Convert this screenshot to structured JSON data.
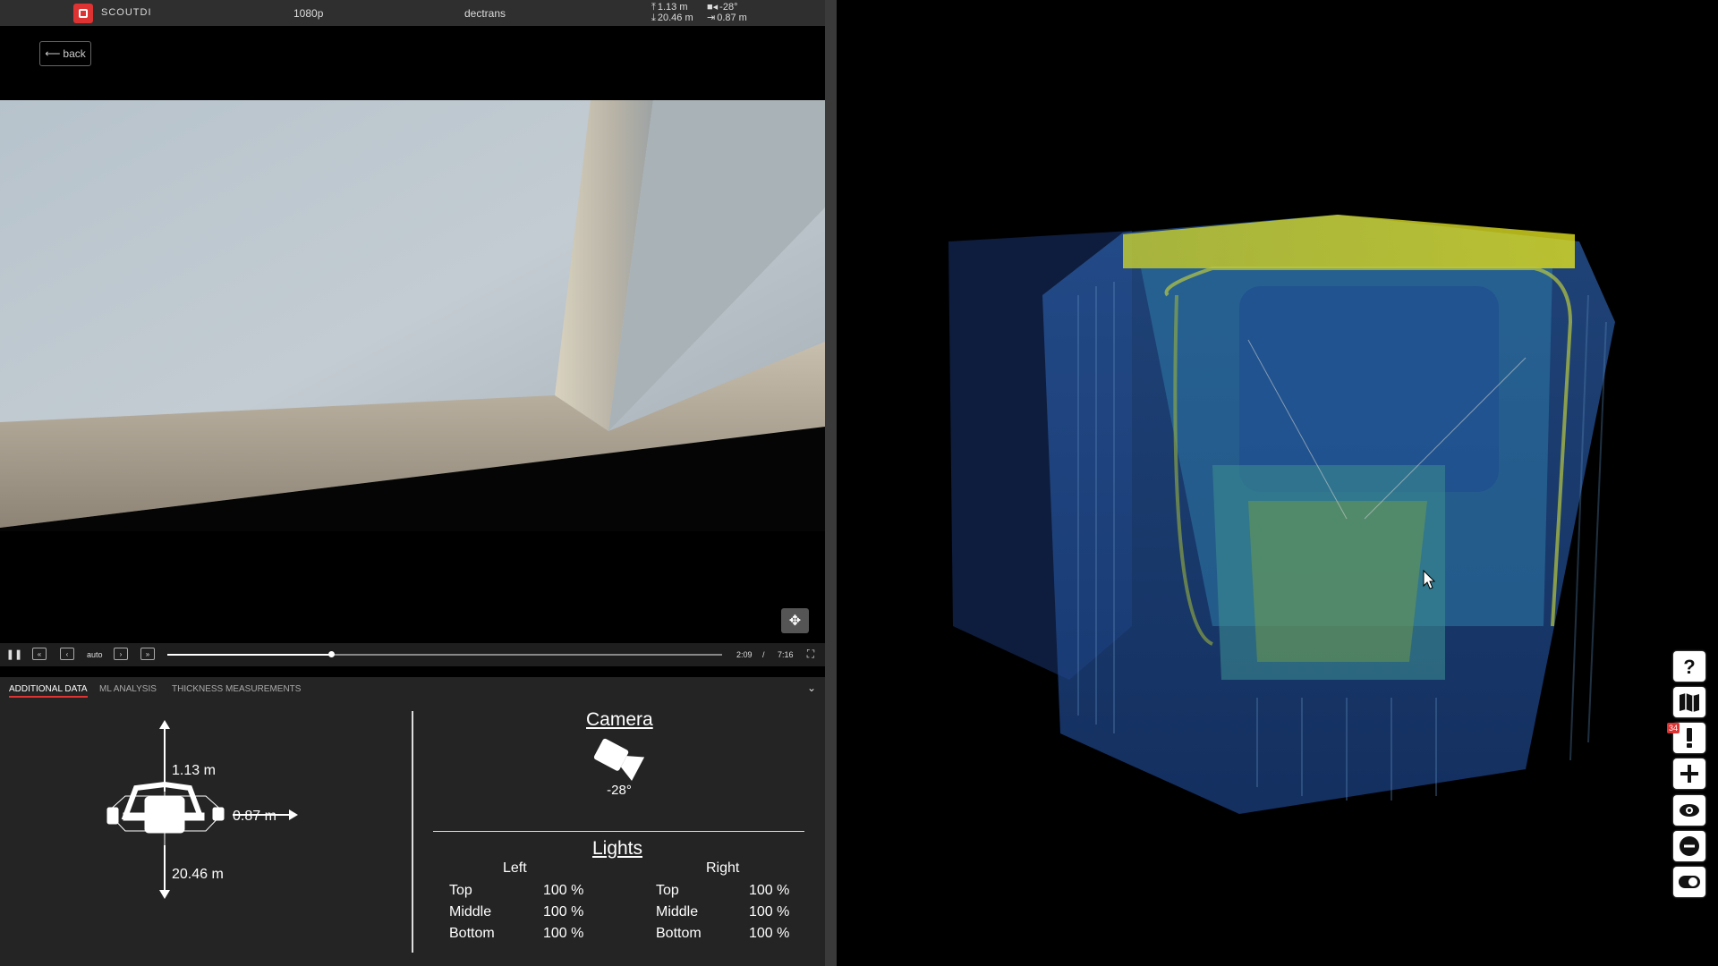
{
  "topbar": {
    "logo_text": "SCOUTDI",
    "resolution": "1080p",
    "user": "dectrans",
    "position": {
      "up": "1.13 m",
      "camera_angle": "-28°",
      "down": "20.46 m",
      "side": "0.87 m"
    }
  },
  "back_label": "back",
  "controls": {
    "auto_label": "auto",
    "current_time": "2:09",
    "separator": "/",
    "total_time": "7:16",
    "progress": 0.295
  },
  "tabs": [
    {
      "label": "ADDITIONAL DATA",
      "active": true
    },
    {
      "label": "ML ANALYSIS",
      "active": false
    },
    {
      "label": "THICKNESS MEASUREMENTS",
      "active": false
    }
  ],
  "dimensions": {
    "up": "1.13 m",
    "side": "0.87 m",
    "down": "20.46 m"
  },
  "camera": {
    "title": "Camera",
    "angle": "-28°"
  },
  "lights": {
    "title": "Lights",
    "left_header": "Left",
    "right_header": "Right",
    "rows": [
      {
        "label": "Top",
        "left": "100 %",
        "right": "100 %"
      },
      {
        "label": "Middle",
        "left": "100 %",
        "right": "100 %"
      },
      {
        "label": "Bottom",
        "left": "100 %",
        "right": "100 %"
      }
    ]
  },
  "sidebar": {
    "badge_count": "34",
    "icons": [
      "help-icon",
      "map-icon",
      "alert-icon",
      "plus-icon",
      "eye-icon",
      "minus-icon",
      "toggle-icon"
    ]
  },
  "colors": {
    "accent": "#dd3333",
    "panel_bg": "#242424",
    "topbar_bg": "#2f2f2f"
  }
}
